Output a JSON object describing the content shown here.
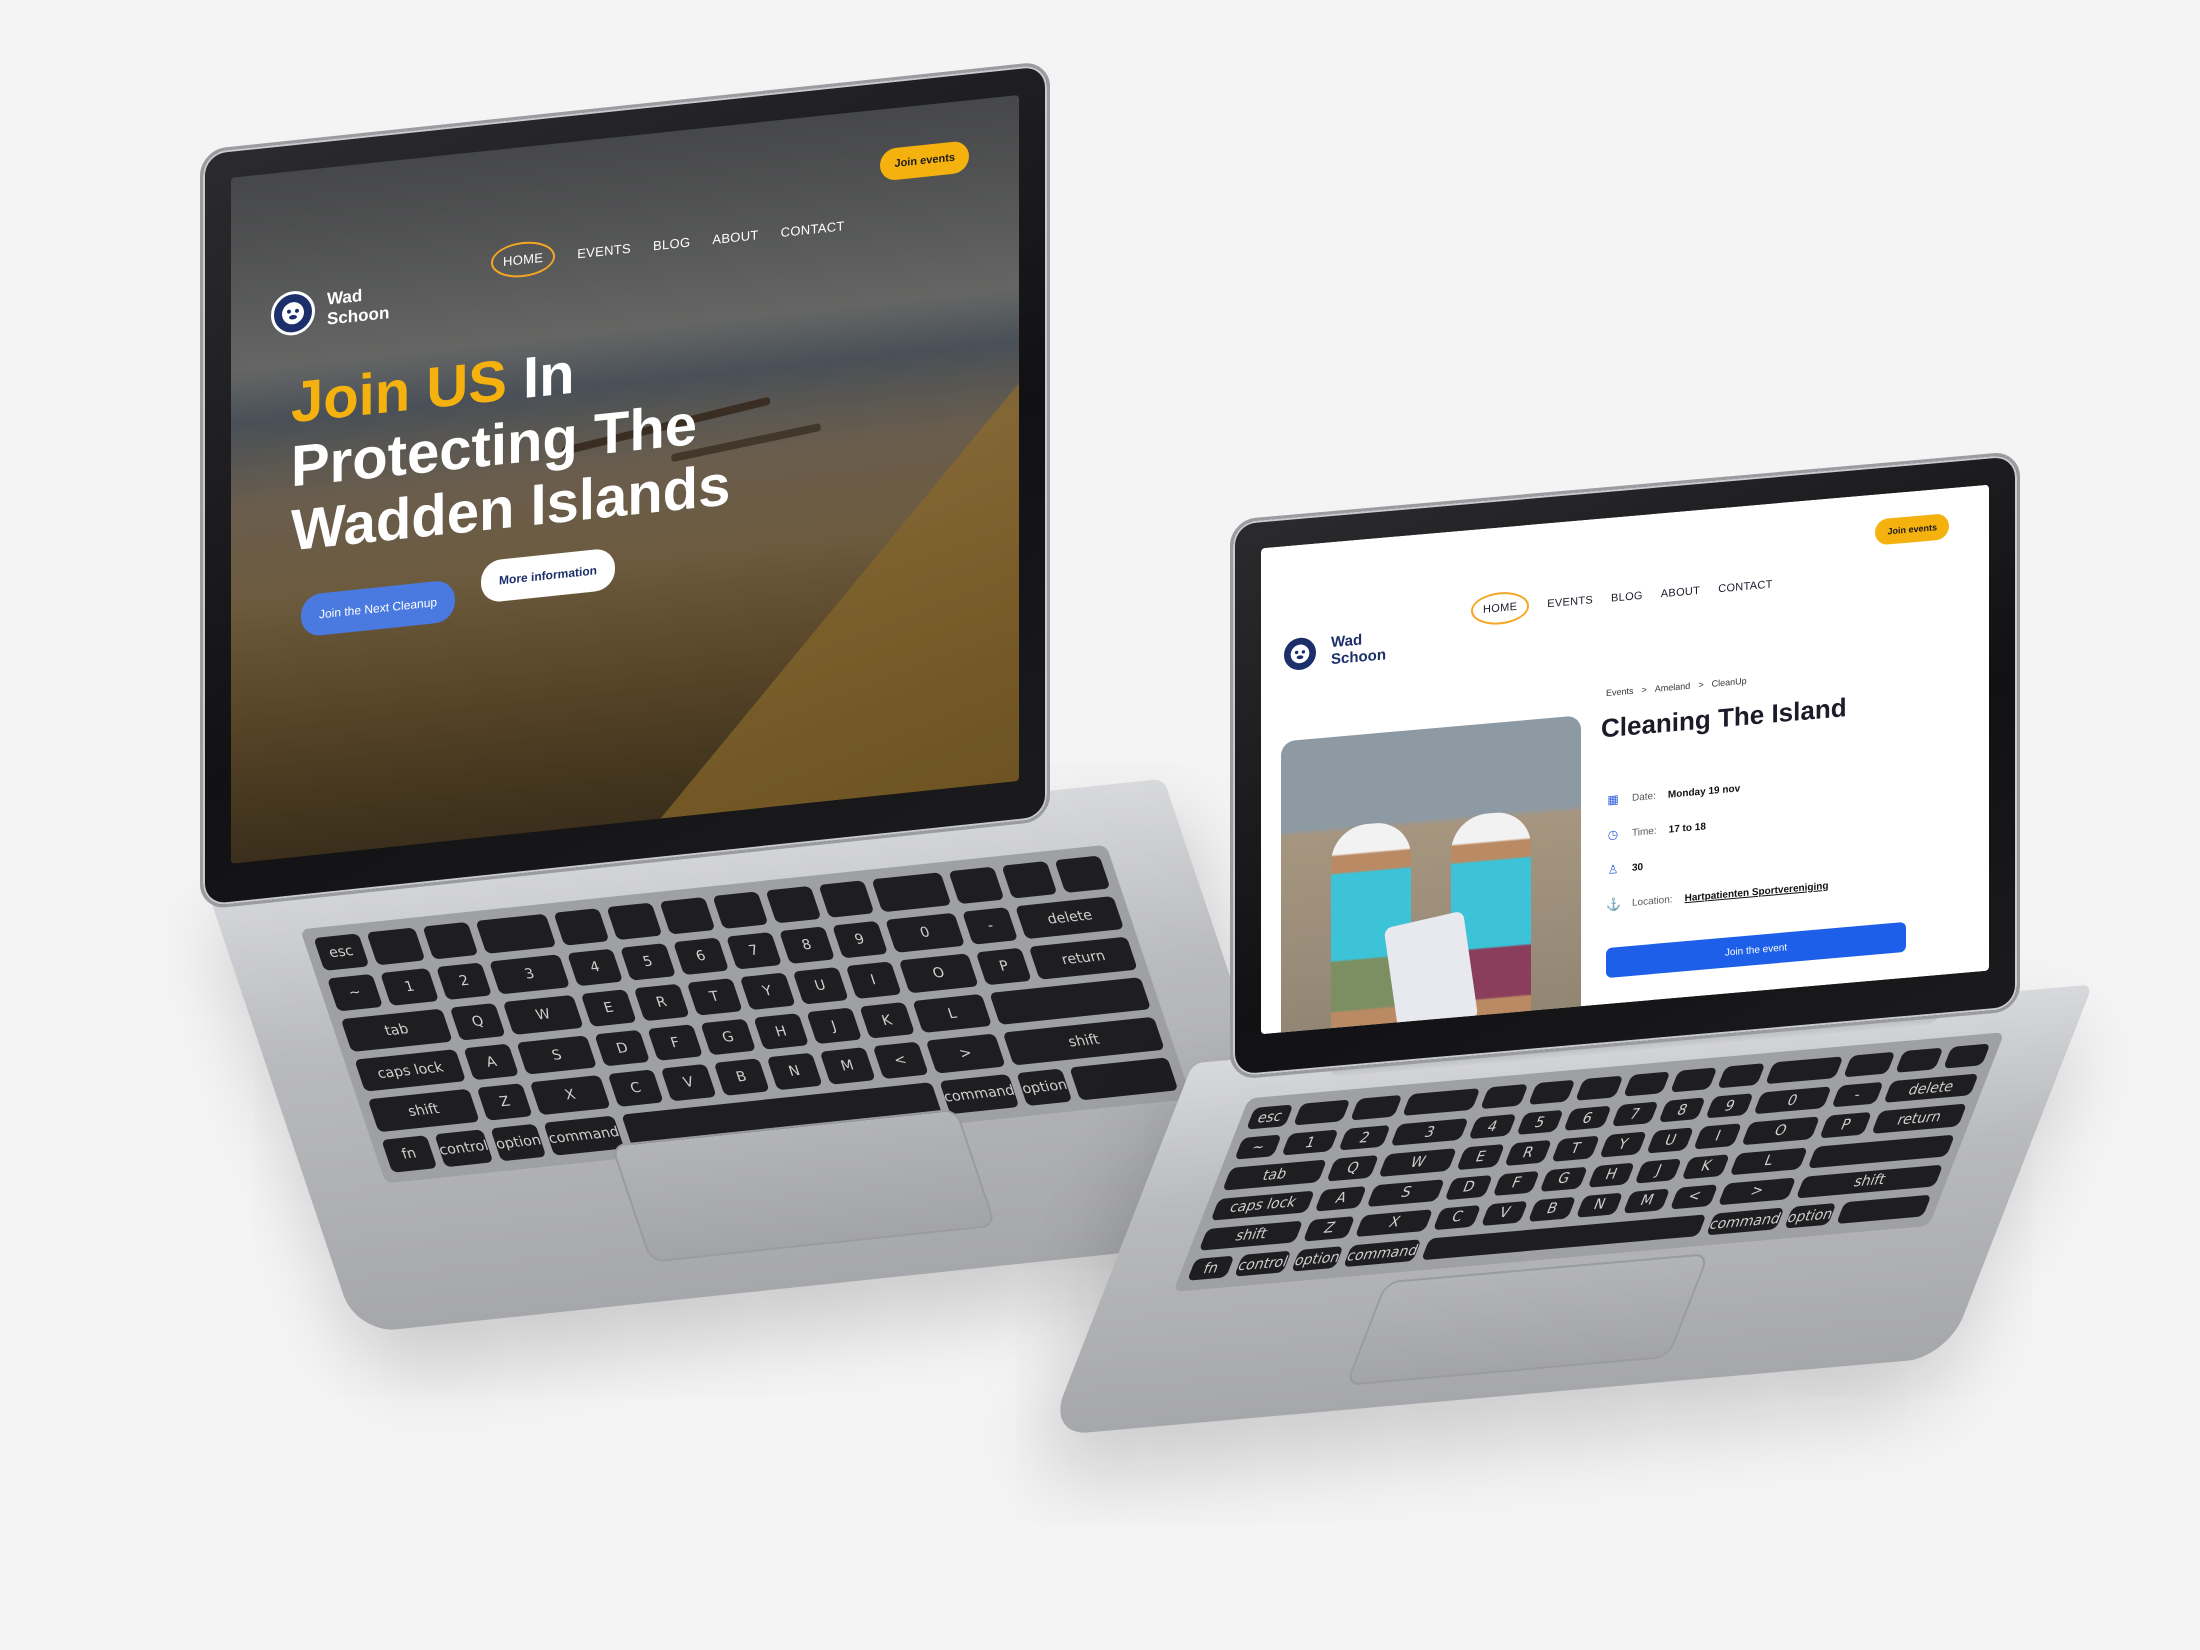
{
  "brand": {
    "name_line1": "Wad",
    "name_line2": "Schoon",
    "logo_icon": "seal-logo-icon",
    "colors": {
      "accent": "#f5b20e",
      "navy": "#1d2f6b",
      "primary_blue": "#1d5fe8"
    }
  },
  "nav": {
    "items": [
      "HOME",
      "EVENTS",
      "BLOG",
      "ABOUT",
      "CONTACT"
    ],
    "active": "HOME",
    "cta_label": "Join events"
  },
  "hero": {
    "title_accent": "Join US",
    "title_rest_1": " In",
    "title_line2": "Protecting The",
    "title_line3": "Wadden Islands",
    "primary_button": "Join the Next Cleanup",
    "secondary_button": "More information"
  },
  "event": {
    "breadcrumb": [
      "Events",
      "Ameland",
      "CleanUp"
    ],
    "breadcrumb_separator": ">",
    "title": "Cleaning The Island",
    "date_label": "Date:",
    "date_value": "Monday 19 nov",
    "time_label": "Time:",
    "time_value": "17 to 18",
    "attendees": "30",
    "location_label": "Location:",
    "location_value": "Hartpatienten Sportvereniging",
    "join_button": "Join the event",
    "icons": [
      "calendar-icon",
      "clock-icon",
      "person-icon",
      "location-pin-icon"
    ]
  }
}
